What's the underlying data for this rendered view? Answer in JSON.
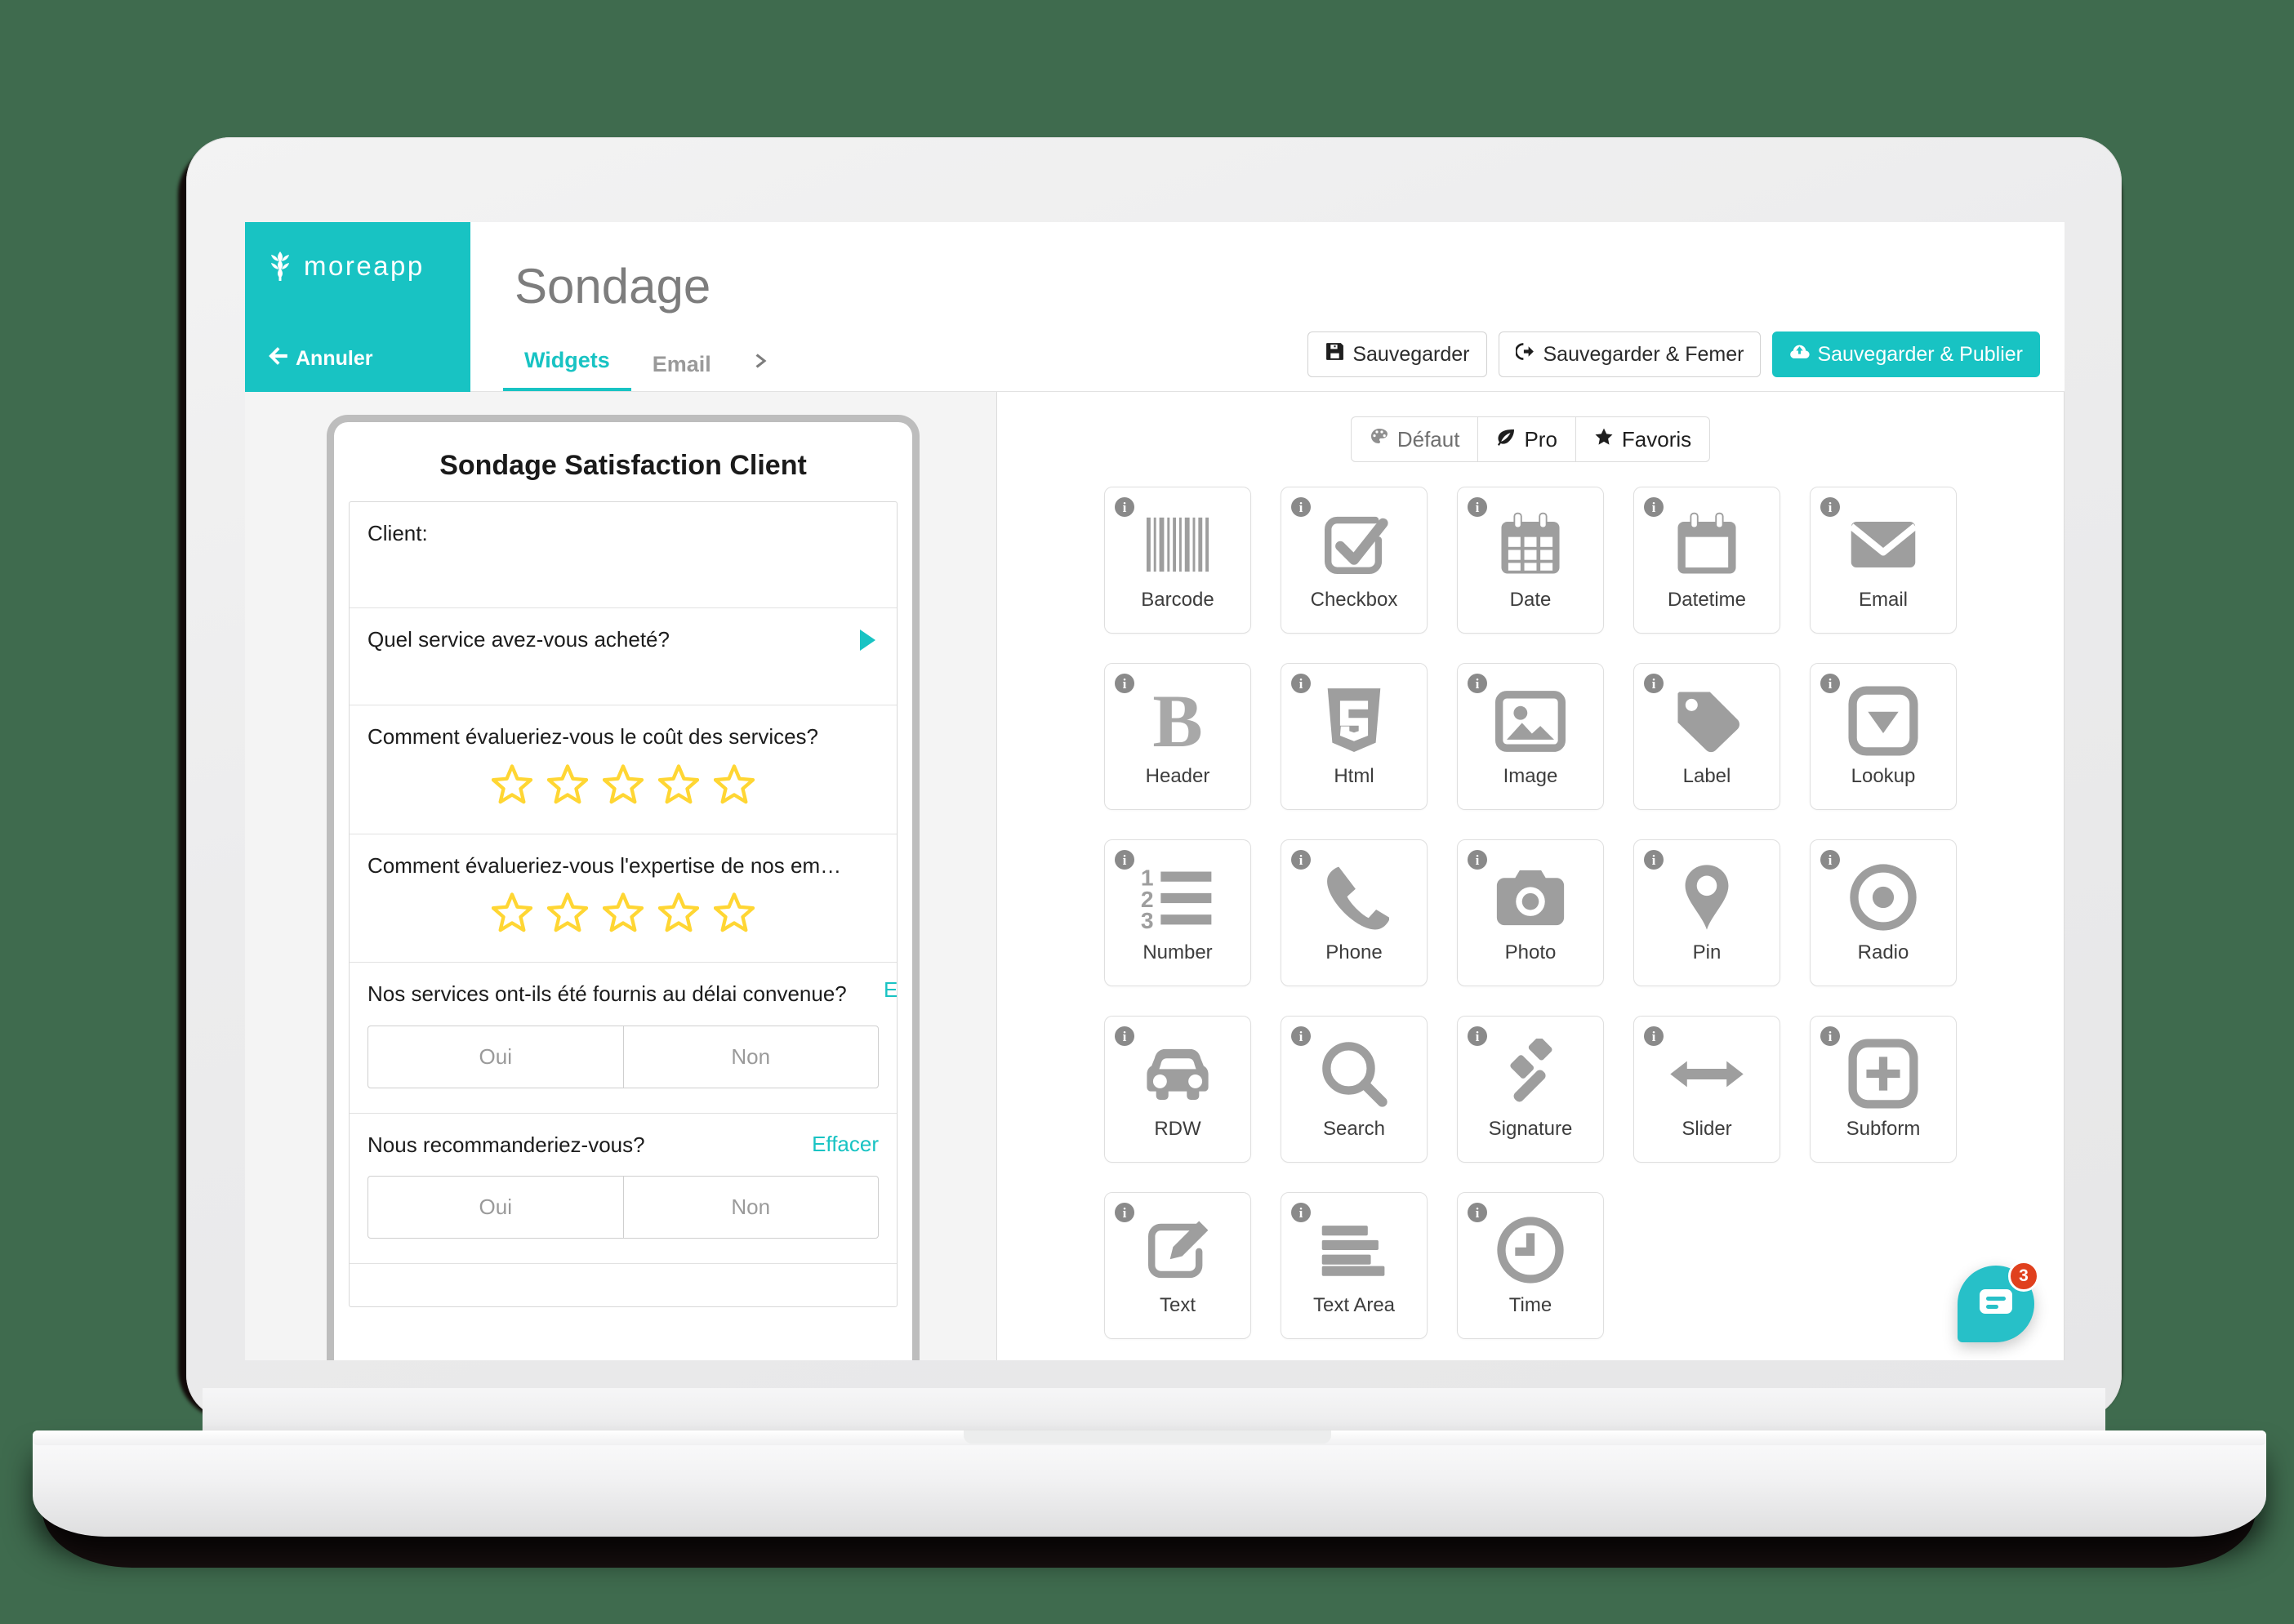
{
  "brand": {
    "name": "moreapp",
    "logo_icon": "wheat-icon"
  },
  "header": {
    "title": "Sondage",
    "cancel_label": "Annuler",
    "back_icon": "arrow-left-icon",
    "tabs": [
      {
        "label": "Widgets",
        "active": true
      },
      {
        "label": "Email",
        "active": false
      }
    ],
    "more_tabs_icon": "chevron-right-icon",
    "actions": [
      {
        "label": "Sauvegarder",
        "icon": "save-floppy-icon",
        "style": "default"
      },
      {
        "label": "Sauvegarder & Femer",
        "icon": "sign-out-icon",
        "style": "default"
      },
      {
        "label": "Sauvegarder & Publier",
        "icon": "cloud-upload-icon",
        "style": "primary"
      }
    ]
  },
  "preview": {
    "form_title": "Sondage Satisfaction Client",
    "rows": [
      {
        "type": "text",
        "label": "Client:"
      },
      {
        "type": "lookup",
        "label": "Quel service avez-vous acheté?",
        "icon": "caret-right-icon"
      },
      {
        "type": "rating",
        "label": "Comment évalueriez-vous le coût des services?",
        "stars": 5,
        "filled": 0
      },
      {
        "type": "rating",
        "label": "Comment évalueriez-vous l'expertise de nos em…",
        "stars": 5,
        "filled": 0
      },
      {
        "type": "yesno",
        "label": "Nos services ont-ils été fournis au délai convenue?",
        "clear_label": "Effacer",
        "clear_clipped": true,
        "yes": "Oui",
        "no": "Non"
      },
      {
        "type": "yesno",
        "label": "Nous recommanderiez-vous?",
        "clear_label": "Effacer",
        "clear_clipped": false,
        "yes": "Oui",
        "no": "Non"
      }
    ]
  },
  "widgets": {
    "filters": [
      {
        "label": "Défaut",
        "icon": "palette-icon",
        "active": false
      },
      {
        "label": "Pro",
        "icon": "leaf-icon",
        "active": true
      },
      {
        "label": "Favoris",
        "icon": "star-icon",
        "active": false
      }
    ],
    "info_glyph": "i",
    "items": [
      {
        "label": "Barcode",
        "icon": "barcode-icon"
      },
      {
        "label": "Checkbox",
        "icon": "checkbox-check-icon"
      },
      {
        "label": "Date",
        "icon": "calendar-grid-icon"
      },
      {
        "label": "Datetime",
        "icon": "calendar-blank-icon"
      },
      {
        "label": "Email",
        "icon": "envelope-icon"
      },
      {
        "label": "Header",
        "icon": "bold-b-icon"
      },
      {
        "label": "Html",
        "icon": "html5-shield-icon"
      },
      {
        "label": "Image",
        "icon": "picture-icon"
      },
      {
        "label": "Label",
        "icon": "tag-icon"
      },
      {
        "label": "Lookup",
        "icon": "dropdown-box-icon"
      },
      {
        "label": "Number",
        "icon": "numbered-list-icon"
      },
      {
        "label": "Phone",
        "icon": "phone-handset-icon"
      },
      {
        "label": "Photo",
        "icon": "camera-icon"
      },
      {
        "label": "Pin",
        "icon": "map-pin-icon"
      },
      {
        "label": "Radio",
        "icon": "radio-dot-icon"
      },
      {
        "label": "RDW",
        "icon": "car-icon"
      },
      {
        "label": "Search",
        "icon": "magnifier-icon"
      },
      {
        "label": "Signature",
        "icon": "gavel-icon"
      },
      {
        "label": "Slider",
        "icon": "double-arrow-icon"
      },
      {
        "label": "Subform",
        "icon": "plus-box-icon"
      },
      {
        "label": "Text",
        "icon": "pencil-square-icon"
      },
      {
        "label": "Text Area",
        "icon": "text-lines-icon"
      },
      {
        "label": "Time",
        "icon": "clock-icon"
      }
    ]
  },
  "chat": {
    "badge_count": "3",
    "icon": "chat-bubble-icon"
  },
  "colors": {
    "accent": "#18c3c3",
    "star": "#ffd633",
    "icon_gray": "#a8a8a8",
    "badge_red": "#e0401d",
    "page_background": "#3f6b4e"
  }
}
